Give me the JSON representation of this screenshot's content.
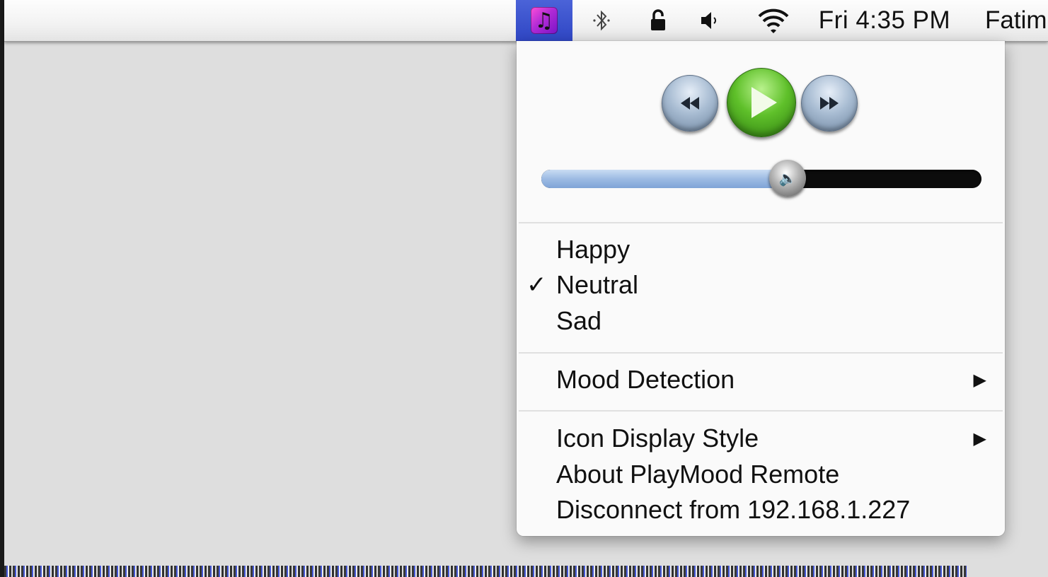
{
  "menubar": {
    "app_icon_glyph": "♫",
    "bluetooth_icon": "bluetooth-icon",
    "lock_icon": "lock-icon",
    "volume_icon": "volume-icon",
    "wifi_icon": "wifi-icon",
    "clock": "Fri 4:35 PM",
    "user": "Fatim",
    "highlight_color": "#3a53cf"
  },
  "player": {
    "prev_icon": "rewind-icon",
    "play_icon": "play-icon",
    "next_icon": "fast-forward-icon",
    "volume_level": 0.56
  },
  "mood_items": [
    {
      "label": "Happy",
      "checked": false
    },
    {
      "label": "Neutral",
      "checked": true
    },
    {
      "label": "Sad",
      "checked": false
    }
  ],
  "check_glyph": "✓",
  "submenu_arrow": "▶",
  "mood_detection": {
    "label": "Mood Detection"
  },
  "icon_display_style": {
    "label": "Icon Display Style"
  },
  "about": {
    "label": "About PlayMood Remote"
  },
  "disconnect": {
    "label": "Disconnect from 192.168.1.227"
  }
}
